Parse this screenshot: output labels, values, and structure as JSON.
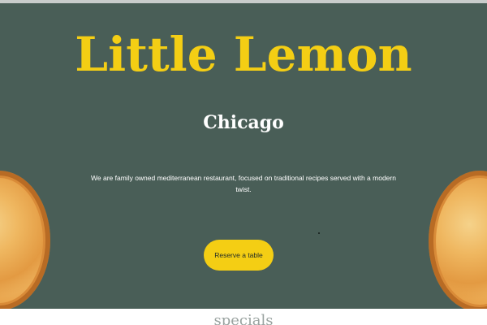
{
  "hero": {
    "title": "Little Lemon",
    "subtitle": "Chicago",
    "description": "We are family owned mediterranean restaurant, focused on traditional recipes served with a modern twist.",
    "reserve_label": "Reserve a table"
  },
  "section_heading": "specials",
  "colors": {
    "hero_background": "#495e57",
    "accent_yellow": "#f4ce14",
    "text_white": "#ffffff"
  },
  "images": {
    "left": "pizza-image",
    "right": "pizza-image"
  }
}
